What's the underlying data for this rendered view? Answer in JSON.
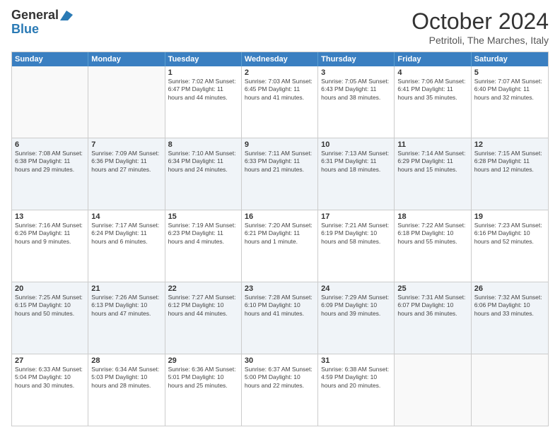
{
  "header": {
    "logo_line1": "General",
    "logo_line2": "Blue",
    "title": "October 2024",
    "subtitle": "Petritoli, The Marches, Italy"
  },
  "weekdays": [
    "Sunday",
    "Monday",
    "Tuesday",
    "Wednesday",
    "Thursday",
    "Friday",
    "Saturday"
  ],
  "rows": [
    [
      {
        "day": "",
        "info": ""
      },
      {
        "day": "",
        "info": ""
      },
      {
        "day": "1",
        "info": "Sunrise: 7:02 AM\nSunset: 6:47 PM\nDaylight: 11 hours and 44 minutes."
      },
      {
        "day": "2",
        "info": "Sunrise: 7:03 AM\nSunset: 6:45 PM\nDaylight: 11 hours and 41 minutes."
      },
      {
        "day": "3",
        "info": "Sunrise: 7:05 AM\nSunset: 6:43 PM\nDaylight: 11 hours and 38 minutes."
      },
      {
        "day": "4",
        "info": "Sunrise: 7:06 AM\nSunset: 6:41 PM\nDaylight: 11 hours and 35 minutes."
      },
      {
        "day": "5",
        "info": "Sunrise: 7:07 AM\nSunset: 6:40 PM\nDaylight: 11 hours and 32 minutes."
      }
    ],
    [
      {
        "day": "6",
        "info": "Sunrise: 7:08 AM\nSunset: 6:38 PM\nDaylight: 11 hours and 29 minutes."
      },
      {
        "day": "7",
        "info": "Sunrise: 7:09 AM\nSunset: 6:36 PM\nDaylight: 11 hours and 27 minutes."
      },
      {
        "day": "8",
        "info": "Sunrise: 7:10 AM\nSunset: 6:34 PM\nDaylight: 11 hours and 24 minutes."
      },
      {
        "day": "9",
        "info": "Sunrise: 7:11 AM\nSunset: 6:33 PM\nDaylight: 11 hours and 21 minutes."
      },
      {
        "day": "10",
        "info": "Sunrise: 7:13 AM\nSunset: 6:31 PM\nDaylight: 11 hours and 18 minutes."
      },
      {
        "day": "11",
        "info": "Sunrise: 7:14 AM\nSunset: 6:29 PM\nDaylight: 11 hours and 15 minutes."
      },
      {
        "day": "12",
        "info": "Sunrise: 7:15 AM\nSunset: 6:28 PM\nDaylight: 11 hours and 12 minutes."
      }
    ],
    [
      {
        "day": "13",
        "info": "Sunrise: 7:16 AM\nSunset: 6:26 PM\nDaylight: 11 hours and 9 minutes."
      },
      {
        "day": "14",
        "info": "Sunrise: 7:17 AM\nSunset: 6:24 PM\nDaylight: 11 hours and 6 minutes."
      },
      {
        "day": "15",
        "info": "Sunrise: 7:19 AM\nSunset: 6:23 PM\nDaylight: 11 hours and 4 minutes."
      },
      {
        "day": "16",
        "info": "Sunrise: 7:20 AM\nSunset: 6:21 PM\nDaylight: 11 hours and 1 minute."
      },
      {
        "day": "17",
        "info": "Sunrise: 7:21 AM\nSunset: 6:19 PM\nDaylight: 10 hours and 58 minutes."
      },
      {
        "day": "18",
        "info": "Sunrise: 7:22 AM\nSunset: 6:18 PM\nDaylight: 10 hours and 55 minutes."
      },
      {
        "day": "19",
        "info": "Sunrise: 7:23 AM\nSunset: 6:16 PM\nDaylight: 10 hours and 52 minutes."
      }
    ],
    [
      {
        "day": "20",
        "info": "Sunrise: 7:25 AM\nSunset: 6:15 PM\nDaylight: 10 hours and 50 minutes."
      },
      {
        "day": "21",
        "info": "Sunrise: 7:26 AM\nSunset: 6:13 PM\nDaylight: 10 hours and 47 minutes."
      },
      {
        "day": "22",
        "info": "Sunrise: 7:27 AM\nSunset: 6:12 PM\nDaylight: 10 hours and 44 minutes."
      },
      {
        "day": "23",
        "info": "Sunrise: 7:28 AM\nSunset: 6:10 PM\nDaylight: 10 hours and 41 minutes."
      },
      {
        "day": "24",
        "info": "Sunrise: 7:29 AM\nSunset: 6:09 PM\nDaylight: 10 hours and 39 minutes."
      },
      {
        "day": "25",
        "info": "Sunrise: 7:31 AM\nSunset: 6:07 PM\nDaylight: 10 hours and 36 minutes."
      },
      {
        "day": "26",
        "info": "Sunrise: 7:32 AM\nSunset: 6:06 PM\nDaylight: 10 hours and 33 minutes."
      }
    ],
    [
      {
        "day": "27",
        "info": "Sunrise: 6:33 AM\nSunset: 5:04 PM\nDaylight: 10 hours and 30 minutes."
      },
      {
        "day": "28",
        "info": "Sunrise: 6:34 AM\nSunset: 5:03 PM\nDaylight: 10 hours and 28 minutes."
      },
      {
        "day": "29",
        "info": "Sunrise: 6:36 AM\nSunset: 5:01 PM\nDaylight: 10 hours and 25 minutes."
      },
      {
        "day": "30",
        "info": "Sunrise: 6:37 AM\nSunset: 5:00 PM\nDaylight: 10 hours and 22 minutes."
      },
      {
        "day": "31",
        "info": "Sunrise: 6:38 AM\nSunset: 4:59 PM\nDaylight: 10 hours and 20 minutes."
      },
      {
        "day": "",
        "info": ""
      },
      {
        "day": "",
        "info": ""
      }
    ]
  ]
}
